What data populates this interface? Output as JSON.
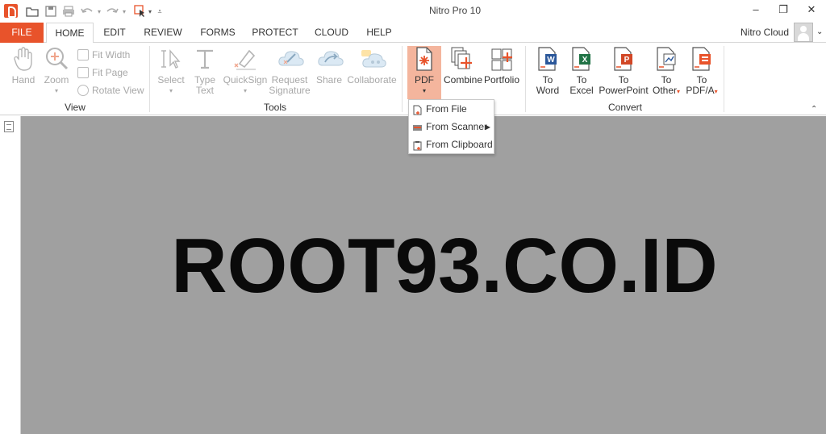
{
  "window": {
    "title": "Nitro Pro 10",
    "minimize": "–",
    "restore": "❐",
    "close": "✕"
  },
  "quick_access": [
    {
      "name": "open-folder-icon"
    },
    {
      "name": "save-icon"
    },
    {
      "name": "print-icon"
    },
    {
      "name": "undo-icon"
    },
    {
      "name": "redo-icon"
    },
    {
      "name": "select-tool-icon"
    },
    {
      "name": "customize-icon"
    }
  ],
  "tabs": [
    {
      "label": "FILE"
    },
    {
      "label": "HOME"
    },
    {
      "label": "EDIT"
    },
    {
      "label": "REVIEW"
    },
    {
      "label": "FORMS"
    },
    {
      "label": "PROTECT"
    },
    {
      "label": "CLOUD"
    },
    {
      "label": "HELP"
    }
  ],
  "active_tab": "HOME",
  "account": {
    "label": "Nitro Cloud"
  },
  "ribbon": {
    "view": {
      "group_label": "View",
      "hand": "Hand",
      "zoom": "Zoom",
      "fit_width": "Fit Width",
      "fit_page": "Fit Page",
      "rotate_view": "Rotate View"
    },
    "tools": {
      "group_label": "Tools",
      "select": "Select",
      "type_text_1": "Type",
      "type_text_2": "Text",
      "quicksign": "QuickSign",
      "request_sig_1": "Request",
      "request_sig_2": "Signature",
      "share": "Share",
      "collaborate": "Collaborate"
    },
    "create": {
      "pdf": "PDF",
      "combine": "Combine",
      "portfolio": "Portfolio"
    },
    "convert": {
      "group_label": "Convert",
      "to_word_1": "To",
      "to_word_2": "Word",
      "to_excel_1": "To",
      "to_excel_2": "Excel",
      "to_ppt_1": "To",
      "to_ppt_2": "PowerPoint",
      "to_other_1": "To",
      "to_other_2": "Other",
      "to_pdfa_1": "To",
      "to_pdfa_2": "PDF/A"
    }
  },
  "pdf_menu": {
    "items": [
      {
        "label": "From File"
      },
      {
        "label": "From Scanner"
      },
      {
        "label": "From Clipboard"
      }
    ]
  },
  "document": {
    "text": "ROOT93.CO.ID"
  },
  "colors": {
    "accent": "#e8532b",
    "pdf_highlight": "#f4b59d",
    "canvas": "#a0a0a0"
  }
}
